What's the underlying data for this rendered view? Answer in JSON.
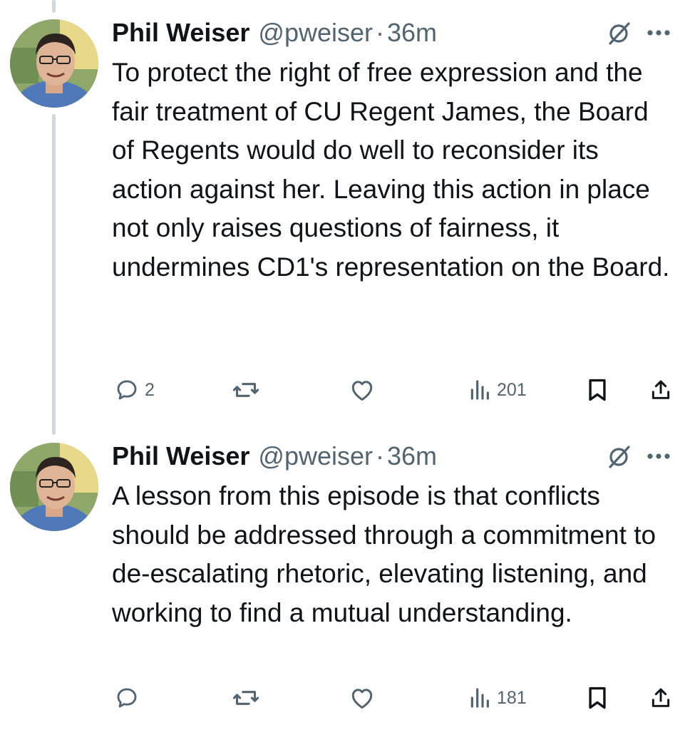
{
  "tweets": [
    {
      "author_name": "Phil Weiser",
      "handle": "@pweiser",
      "separator": "·",
      "time": "36m",
      "text": "To protect the right of free expression and the fair treatment of CU Regent James, the Board of Regents would do well to reconsider its action against her. Leaving this action in place not only raises questions of fairness, it undermines CD1's representation on the Board.",
      "replies": "2",
      "retweets": "",
      "likes": "",
      "views": "201"
    },
    {
      "author_name": "Phil Weiser",
      "handle": "@pweiser",
      "separator": "·",
      "time": "36m",
      "text": "A lesson from this episode is that conflicts should be addressed through a commitment to de-escalating rhetoric, elevating listening, and working to find a mutual understanding.",
      "replies": "",
      "retweets": "",
      "likes": "",
      "views": "181"
    }
  ],
  "icons": {
    "reply": "reply-icon",
    "retweet": "retweet-icon",
    "like": "like-icon",
    "views": "views-icon",
    "bookmark": "bookmark-icon",
    "share": "share-icon",
    "grok": "grok-icon",
    "more": "more-icon"
  },
  "colors": {
    "text": "#0f1419",
    "secondary": "#536471",
    "thread_line": "#cfd9de"
  }
}
